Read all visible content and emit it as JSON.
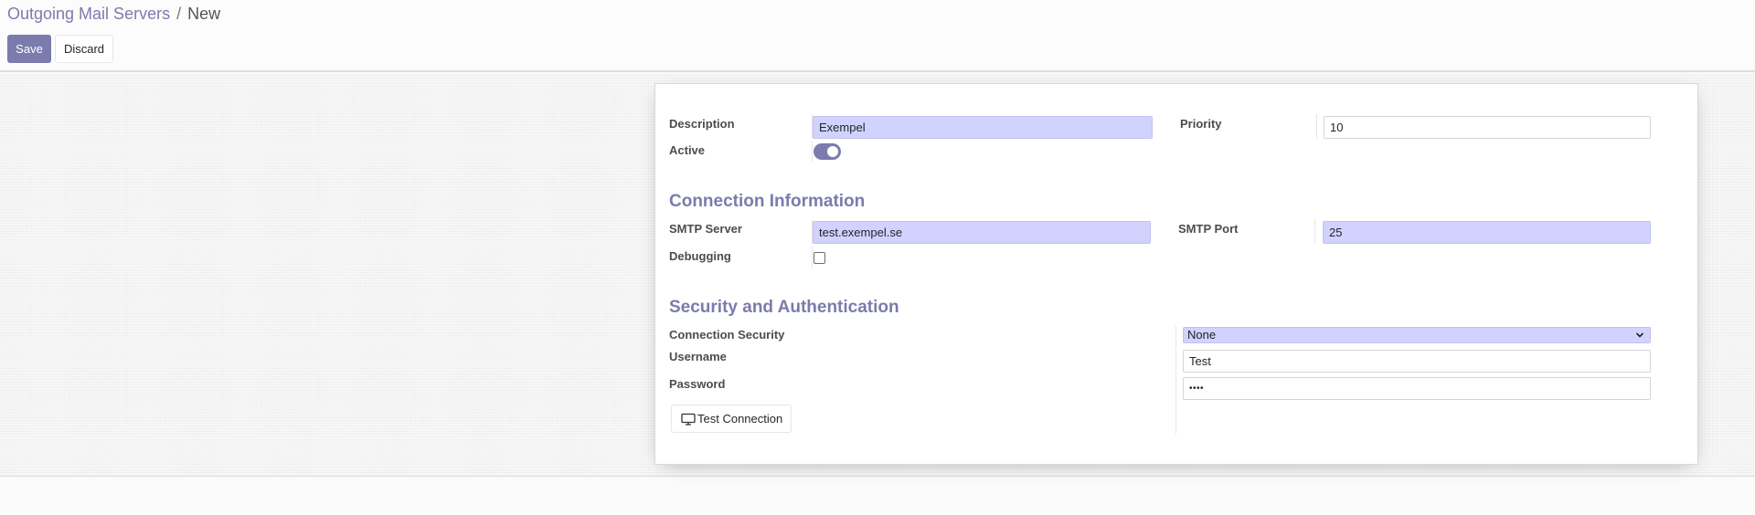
{
  "breadcrumb": {
    "parent": "Outgoing Mail Servers",
    "separator": "/",
    "current": "New"
  },
  "toolbar": {
    "save_label": "Save",
    "discard_label": "Discard"
  },
  "form": {
    "description": {
      "label": "Description",
      "value": "Exempel"
    },
    "priority": {
      "label": "Priority",
      "value": "10"
    },
    "active": {
      "label": "Active",
      "checked": true
    },
    "connection_section": {
      "title": "Connection Information",
      "smtp_server": {
        "label": "SMTP Server",
        "value": "test.exempel.se"
      },
      "smtp_port": {
        "label": "SMTP Port",
        "value": "25"
      },
      "debugging": {
        "label": "Debugging",
        "checked": false
      }
    },
    "security_section": {
      "title": "Security and Authentication",
      "connection_security": {
        "label": "Connection Security",
        "value": "None"
      },
      "username": {
        "label": "Username",
        "value": "Test"
      },
      "password": {
        "label": "Password",
        "value": "••••"
      }
    },
    "test_button": {
      "label": "Test Connection",
      "icon": "monitor-icon"
    }
  },
  "colors": {
    "primary": "#7c7bad",
    "required_field": "#d2d2ff"
  }
}
